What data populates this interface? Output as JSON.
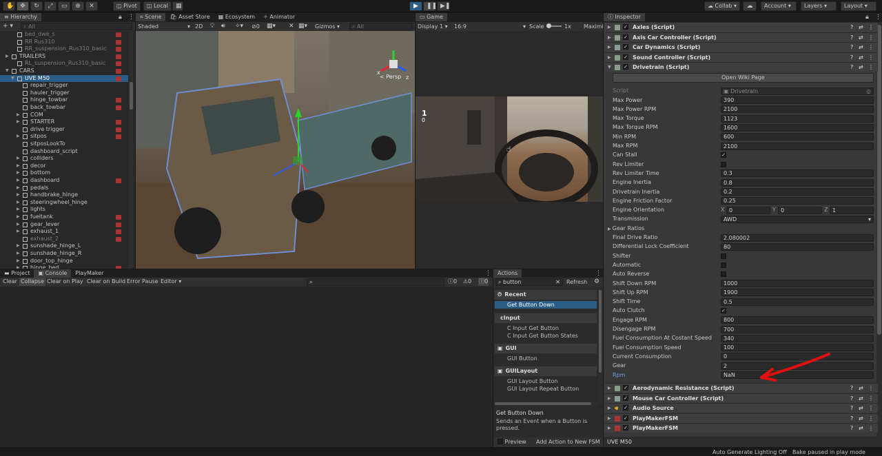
{
  "toolbar": {
    "pivot": "Pivot",
    "local": "Local",
    "collab": "Collab",
    "account": "Account",
    "layers": "Layers",
    "layout": "Layout"
  },
  "hierarchy": {
    "tab": "Hierarchy",
    "search_placeholder": "All",
    "items": [
      {
        "label": "bed_dwe_s",
        "indent": 3,
        "dim": true,
        "pm": true
      },
      {
        "label": "RR Rus310",
        "indent": 3,
        "dim": true,
        "pm": true
      },
      {
        "label": "RR_suspension_Rus310_basic",
        "indent": 3,
        "dim": true,
        "pm": true
      },
      {
        "label": "TRAILERS",
        "indent": 2,
        "arrow": "▶",
        "pm": true
      },
      {
        "label": "RL_suspension_Rus310_basic",
        "indent": 3,
        "dim": true,
        "pm": true
      },
      {
        "label": "CARS",
        "indent": 2,
        "arrow": "▼",
        "pm": true
      },
      {
        "label": "UVE M50",
        "indent": 3,
        "arrow": "▼",
        "pm": true,
        "selected": true
      },
      {
        "label": "repair_trigger",
        "indent": 4
      },
      {
        "label": "hauler_trigger",
        "indent": 4
      },
      {
        "label": "hinge_towbar",
        "indent": 4,
        "pm": true
      },
      {
        "label": "back_towbar",
        "indent": 4,
        "pm": true
      },
      {
        "label": "COM",
        "indent": 4,
        "arrow": "▶"
      },
      {
        "label": "STARTER",
        "indent": 4,
        "arrow": "▶",
        "pm": true
      },
      {
        "label": "drive trigger",
        "indent": 4,
        "pm": true
      },
      {
        "label": "sitpos",
        "indent": 4,
        "arrow": "▶",
        "pm": true
      },
      {
        "label": "sitposLookTo",
        "indent": 4
      },
      {
        "label": "dashboard_script",
        "indent": 4
      },
      {
        "label": "colliders",
        "indent": 4,
        "arrow": "▶"
      },
      {
        "label": "decor",
        "indent": 4,
        "arrow": "▶"
      },
      {
        "label": "bottom",
        "indent": 4,
        "arrow": "▶"
      },
      {
        "label": "dashboard",
        "indent": 4,
        "arrow": "▶",
        "pm": true
      },
      {
        "label": "pedals",
        "indent": 4,
        "arrow": "▶"
      },
      {
        "label": "handbrake_hinge",
        "indent": 4,
        "arrow": "▶"
      },
      {
        "label": "steeringwheel_hinge",
        "indent": 4,
        "arrow": "▶"
      },
      {
        "label": "lights",
        "indent": 4,
        "arrow": "▶"
      },
      {
        "label": "fueltank",
        "indent": 4,
        "arrow": "▶",
        "pm": true
      },
      {
        "label": "gear_lever",
        "indent": 4,
        "arrow": "▶",
        "pm": true
      },
      {
        "label": "exhaust_1",
        "indent": 4,
        "arrow": "▶",
        "pm": true
      },
      {
        "label": "exhaust_2",
        "indent": 4,
        "dim": true,
        "pm": true
      },
      {
        "label": "sunshade_hinge_L",
        "indent": 4,
        "arrow": "▶"
      },
      {
        "label": "sunshade_hinge_R",
        "indent": 4,
        "arrow": "▶"
      },
      {
        "label": "door_top_hinge",
        "indent": 4,
        "arrow": "▶"
      },
      {
        "label": "hinge_bed",
        "indent": 4,
        "arrow": "▶",
        "pm": true
      }
    ]
  },
  "scene": {
    "tabs": [
      "Scene",
      "Asset Store",
      "Ecosystem",
      "Animator"
    ],
    "shading": "Shaded",
    "mode2d": "2D",
    "gizmos": "Gizmos",
    "search_placeholder": "All",
    "persp": "< Persp",
    "layer_count": "0"
  },
  "game": {
    "tab": "Game",
    "display": "Display 1",
    "aspect": "16:9",
    "scale_label": "Scale",
    "scale_value": "1x",
    "maximize": "Maximi",
    "overlay1": "1",
    "overlay2": "0"
  },
  "bottom": {
    "tabs": [
      "Project",
      "Console",
      "PlayMaker"
    ],
    "buttons": [
      "Clear",
      "Collapse",
      "Clear on Play",
      "Clear on Build",
      "Error Pause",
      "Editor"
    ],
    "counts": [
      "0",
      "0",
      "0"
    ]
  },
  "actions": {
    "tab": "Actions",
    "search": "button",
    "refresh": "Refresh",
    "groups": [
      {
        "title": "Recent",
        "items": [
          "Get Button Down"
        ]
      },
      {
        "title": "cInput",
        "items": [
          "C Input Get Button",
          "C Input Get Button States"
        ]
      },
      {
        "title": "GUI",
        "items": [
          "GUI Button"
        ]
      },
      {
        "title": "GUILayout",
        "items": [
          "GUI Layout Button",
          "GUI Layout Repeat Button"
        ]
      }
    ],
    "desc_title": "Get Button Down",
    "desc_text": "Sends an Event when a Button is pressed.",
    "preview": "Preview",
    "add_action": "Add Action to New FSM"
  },
  "inspector": {
    "tab": "Inspector",
    "top_components": [
      "Axles (Script)",
      "Axis Car Controller (Script)",
      "Car Dynamics (Script)",
      "Sound Controller (Script)",
      "Drivetrain (Script)"
    ],
    "open_wiki": "Open Wiki Page",
    "script_label": "Script",
    "script_value": "Drivetrain",
    "fields": [
      {
        "label": "Max Power",
        "value": "390"
      },
      {
        "label": "Max Power RPM",
        "value": "2100"
      },
      {
        "label": "Max Torque",
        "value": "1123"
      },
      {
        "label": "Max Torque RPM",
        "value": "1600"
      },
      {
        "label": "Min RPM",
        "value": "600"
      },
      {
        "label": "Max RPM",
        "value": "2100"
      },
      {
        "label": "Can Stall",
        "check": "✓"
      },
      {
        "label": "Rev Limiter",
        "check": ""
      },
      {
        "label": "Rev Limiter Time",
        "value": "0.3"
      },
      {
        "label": "Engine Inertia",
        "value": "0.8"
      },
      {
        "label": "Drivetrain Inertia",
        "value": "0.2"
      },
      {
        "label": "Engine Friction Factor",
        "value": "0.25"
      },
      {
        "label": "Engine Orientation",
        "xyz": true
      },
      {
        "label": "Transmission",
        "value": "AWD",
        "dropdown": true
      },
      {
        "label": "Gear Ratios",
        "foldout": true
      },
      {
        "label": "Final Drive Ratio",
        "value": "2.080002"
      },
      {
        "label": "Differential Lock Coefficient",
        "value": "80"
      },
      {
        "label": "Shifter",
        "check": ""
      },
      {
        "label": "Automatic",
        "check": ""
      },
      {
        "label": "Auto Reverse",
        "check": ""
      },
      {
        "label": "Shift Down RPM",
        "value": "1000"
      },
      {
        "label": "Shift Up RPM",
        "value": "1900"
      },
      {
        "label": "Shift Time",
        "value": "0.5"
      },
      {
        "label": "Auto Clutch",
        "check": "✓"
      },
      {
        "label": "Engage RPM",
        "value": "800"
      },
      {
        "label": "Disengage RPM",
        "value": "700"
      },
      {
        "label": "Fuel Consumption At Costant Speed",
        "value": "340"
      },
      {
        "label": "Fuel Consumption Speed",
        "value": "100"
      },
      {
        "label": "Current Consumption",
        "value": "0"
      },
      {
        "label": "Gear",
        "value": "2"
      },
      {
        "label": "Rpm",
        "value": "NaN",
        "highlight": true
      }
    ],
    "xyz": {
      "x_label": "X",
      "x": "0",
      "y_label": "Y",
      "y": "0",
      "z_label": "Z",
      "z": "1"
    },
    "bottom_components": [
      "Aerodynamic Resistance (Script)",
      "Mouse Car Controller (Script)",
      "Audio Source",
      "PlayMakerFSM",
      "PlayMakerFSM"
    ],
    "footer": "UVE M50"
  },
  "status": {
    "left": "Auto Generate Lighting Off",
    "right": "Bake paused in play mode"
  },
  "colors": {
    "accent": "#2c5d87",
    "selected": "#2c5d87",
    "annotation": "#e01010"
  }
}
